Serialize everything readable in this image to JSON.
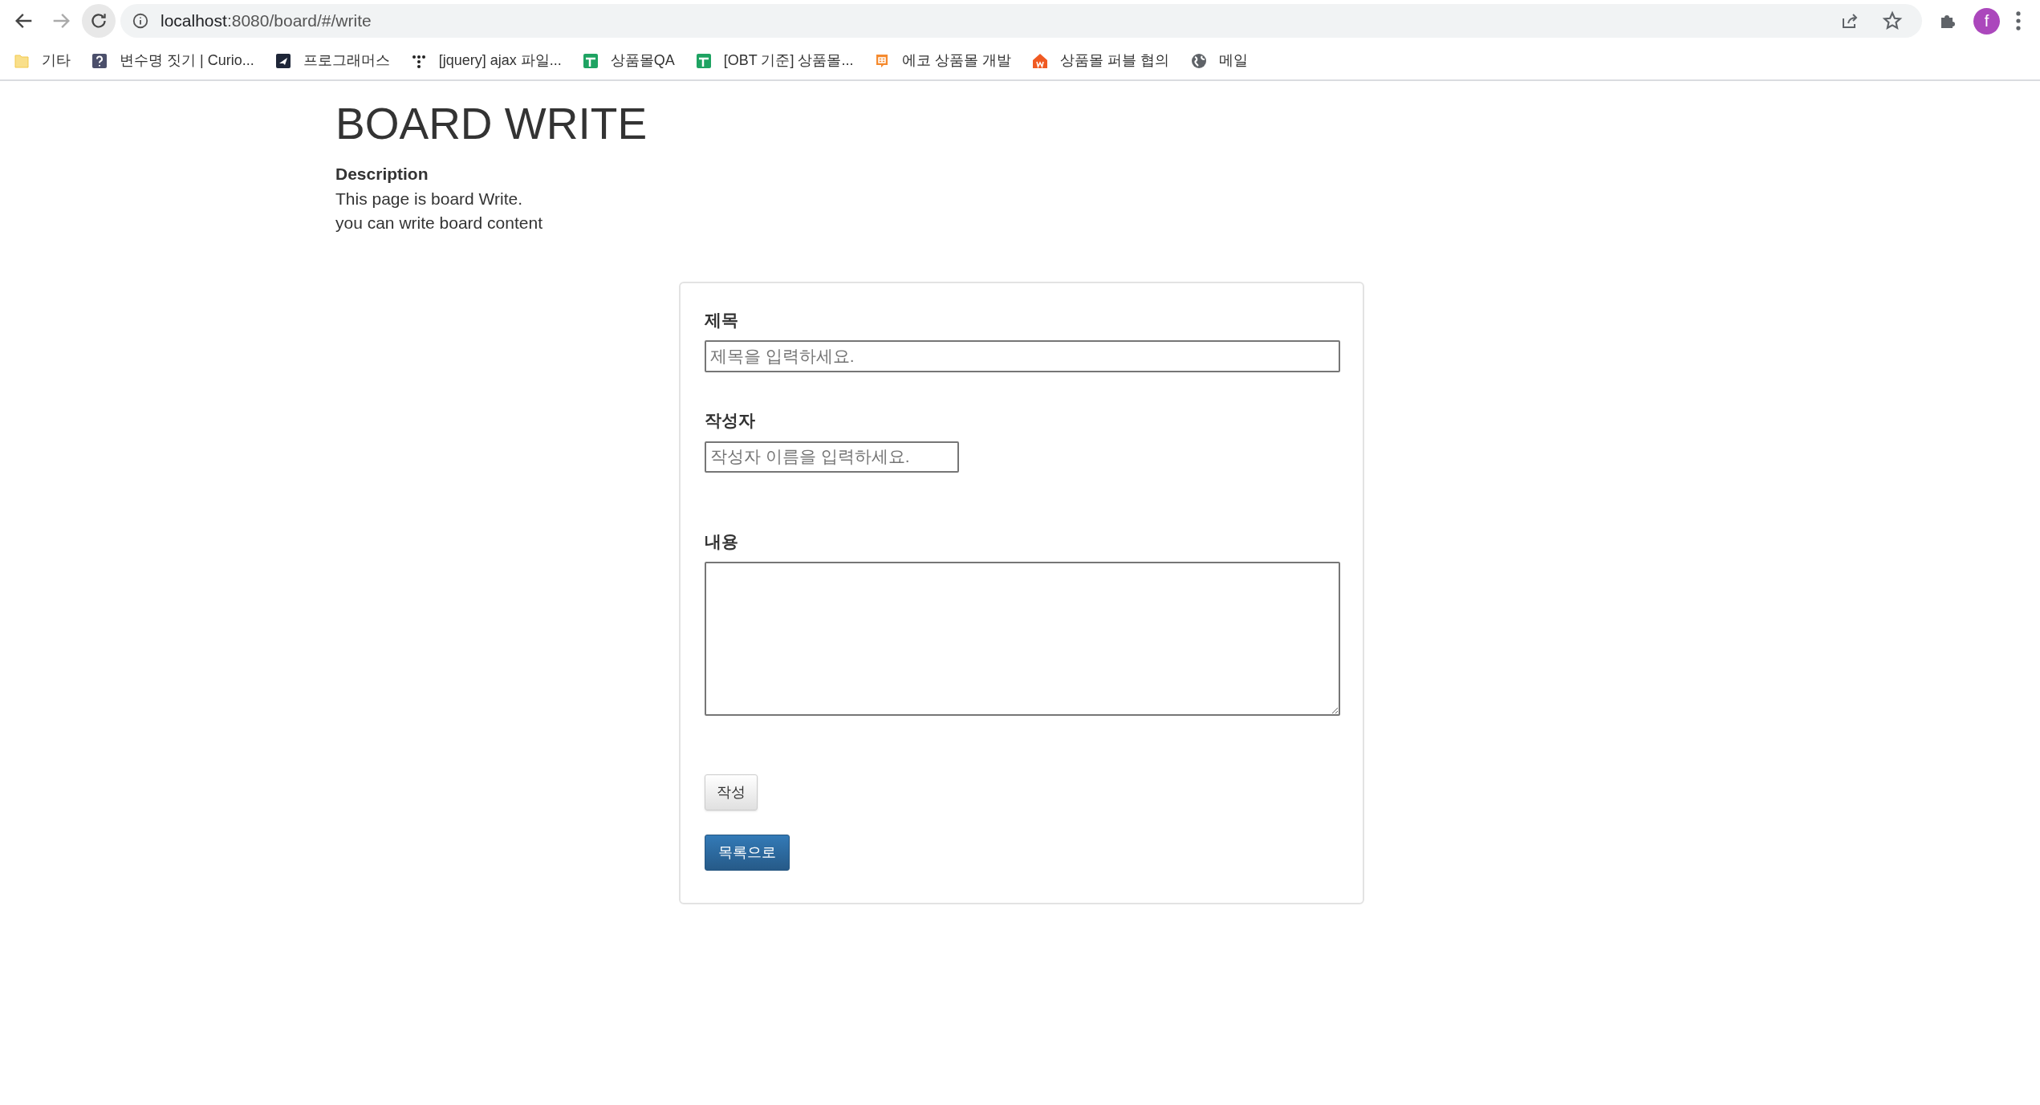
{
  "browser": {
    "url_host": "localhost",
    "url_rest": ":8080/board/#/write",
    "profile_initial": "f"
  },
  "bookmarks": [
    {
      "label": "기타",
      "kind": "folder"
    },
    {
      "label": "변수명 짓기 | Curio...",
      "kind": "help"
    },
    {
      "label": "프로그래머스",
      "kind": "bird"
    },
    {
      "label": "[jquery] ajax 파일...",
      "kind": "dots"
    },
    {
      "label": "상품몰QA",
      "kind": "sheet"
    },
    {
      "label": "[OBT 기준] 상품몰...",
      "kind": "sheet"
    },
    {
      "label": "에코 상품몰 개발",
      "kind": "chat"
    },
    {
      "label": "상품몰 퍼블 협의",
      "kind": "house"
    },
    {
      "label": "메일",
      "kind": "globe"
    }
  ],
  "page": {
    "title": "BOARD WRITE",
    "description_heading": "Description",
    "description_lines": [
      "This page is board Write.",
      "you can write board content"
    ]
  },
  "form": {
    "fields": [
      {
        "label": "제목",
        "kind": "wide",
        "placeholder": "제목을 입력하세요."
      },
      {
        "label": "작성자",
        "kind": "short",
        "placeholder": "작성자 이름을 입력하세요."
      },
      {
        "label": "내용",
        "kind": "textarea"
      }
    ],
    "buttons": [
      {
        "label": "작성",
        "kind": "default"
      },
      {
        "label": "목록으로",
        "kind": "primary"
      }
    ]
  }
}
